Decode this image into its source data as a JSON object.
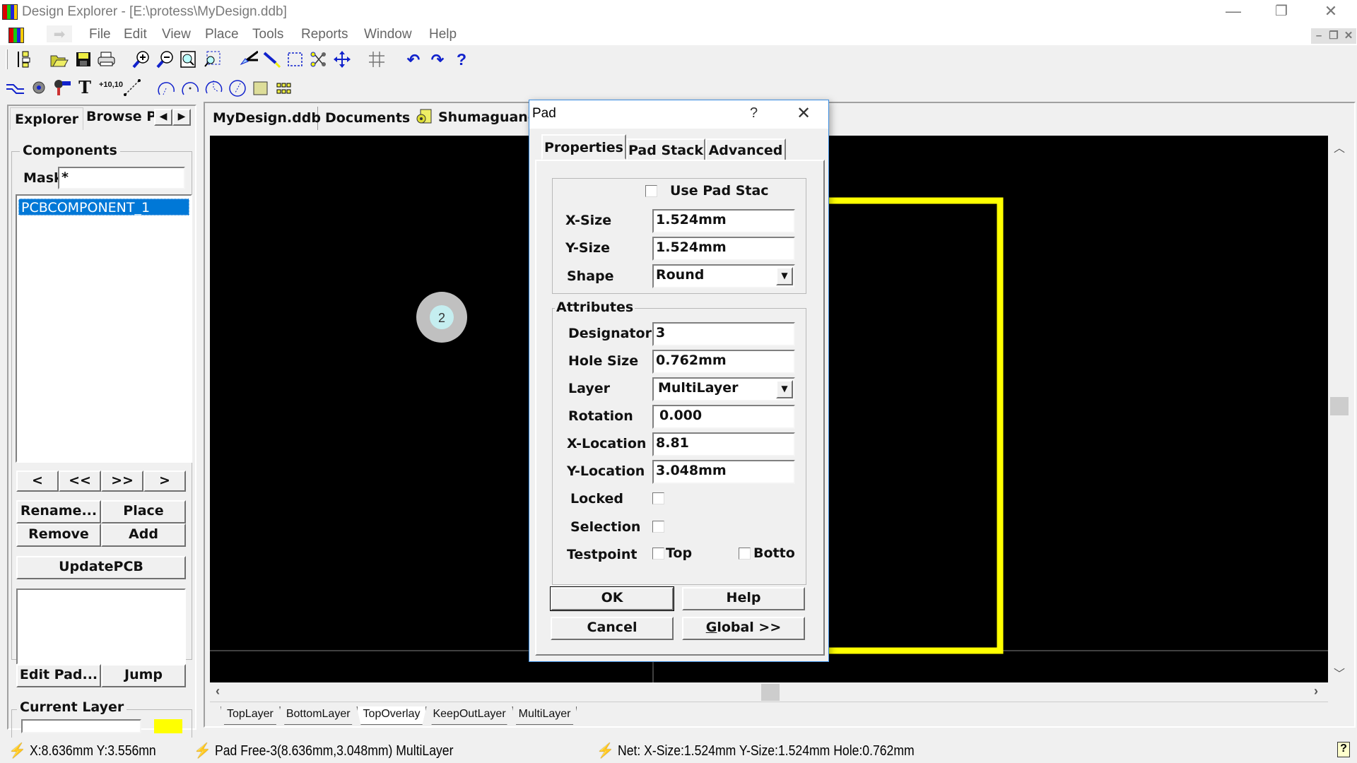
{
  "window": {
    "title": "Design Explorer - [E:\\protess\\MyDesign.ddb]",
    "controls": [
      "minimize",
      "restore",
      "close"
    ]
  },
  "menu": {
    "items": [
      "File",
      "Edit",
      "View",
      "Place",
      "Tools",
      "Reports",
      "Window",
      "Help"
    ]
  },
  "toolbar1": {
    "icons": [
      "design-manager-icon",
      "open-icon",
      "save-icon",
      "print-icon",
      "zoom-in-icon",
      "zoom-out-icon",
      "zoom-fit-icon",
      "zoom-area-icon",
      "cut-icon",
      "pick-icon",
      "select-area-icon",
      "deselect-icon",
      "move-icon",
      "grid-icon",
      "undo-icon",
      "redo-icon",
      "help-icon"
    ]
  },
  "toolbar2": {
    "icons": [
      "track-icon",
      "via-icon",
      "pad-icon",
      "string-icon",
      "coordinate-icon",
      "dimension-icon",
      "arc-center-icon",
      "arc-edge-icon",
      "arc-any-icon",
      "circle-icon",
      "fill-icon",
      "array-icon"
    ],
    "coordinate_label": "+10,10"
  },
  "left_panel": {
    "tabs": [
      "Explorer",
      "Browse P"
    ],
    "components_label": "Components",
    "mask_label": "Mask",
    "mask_value": "*",
    "list_items": [
      "PCBCOMPONENT_1"
    ],
    "nav_buttons": [
      "<",
      "<<",
      ">>",
      ">"
    ],
    "buttons": {
      "rename": "Rename...",
      "place": "Place",
      "remove": "Remove",
      "add": "Add",
      "update_pcb": "UpdatePCB",
      "edit_pad": "Edit Pad...",
      "jump": "Jump"
    },
    "current_layer_label": "Current Layer",
    "current_layer_color": "#ffff00"
  },
  "doc_tabs": [
    "MyDesign.ddb",
    "Documents",
    "Shumaguang"
  ],
  "canvas": {
    "pad_label": "2",
    "outline_color": "#ffff00"
  },
  "layer_tabs": [
    "TopLayer",
    "BottomLayer",
    "TopOverlay",
    "KeepOutLayer",
    "MultiLayer"
  ],
  "dialog": {
    "title": "Pad",
    "help_glyph": "?",
    "tabs": [
      "Properties",
      "Pad Stack",
      "Advanced"
    ],
    "use_pad_stack_label": "Use Pad Stac",
    "use_pad_stack_checked": false,
    "x_size_label": "X-Size",
    "x_size": "1.524mm",
    "y_size_label": "Y-Size",
    "y_size": "1.524mm",
    "shape_label": "Shape",
    "shape": "Round",
    "attributes_label": "Attributes",
    "designator_label": "Designator",
    "designator": "3",
    "hole_size_label": "Hole Size",
    "hole_size": "0.762mm",
    "layer_label": "Layer",
    "layer": "MultiLayer",
    "rotation_label": "Rotation",
    "rotation": "0.000",
    "x_location_label": "X-Location",
    "x_location": "8.81",
    "y_location_label": "Y-Location",
    "y_location": "3.048mm",
    "locked_label": "Locked",
    "locked": false,
    "selection_label": "Selection",
    "selection": false,
    "testpoint_label": "Testpoint",
    "testpoint_top_label": "Top",
    "testpoint_top": false,
    "testpoint_bottom_label": "Botto",
    "testpoint_bottom": false,
    "ok": "OK",
    "help": "Help",
    "cancel": "Cancel",
    "global": "Global >>"
  },
  "status": {
    "coords": "X:8.636mm Y:3.556mn",
    "object": "Pad Free-3(8.636mm,3.048mm)  MultiLayer",
    "net": "Net: X-Size:1.524mm Y-Size:1.524mm Hole:0.762mm"
  }
}
